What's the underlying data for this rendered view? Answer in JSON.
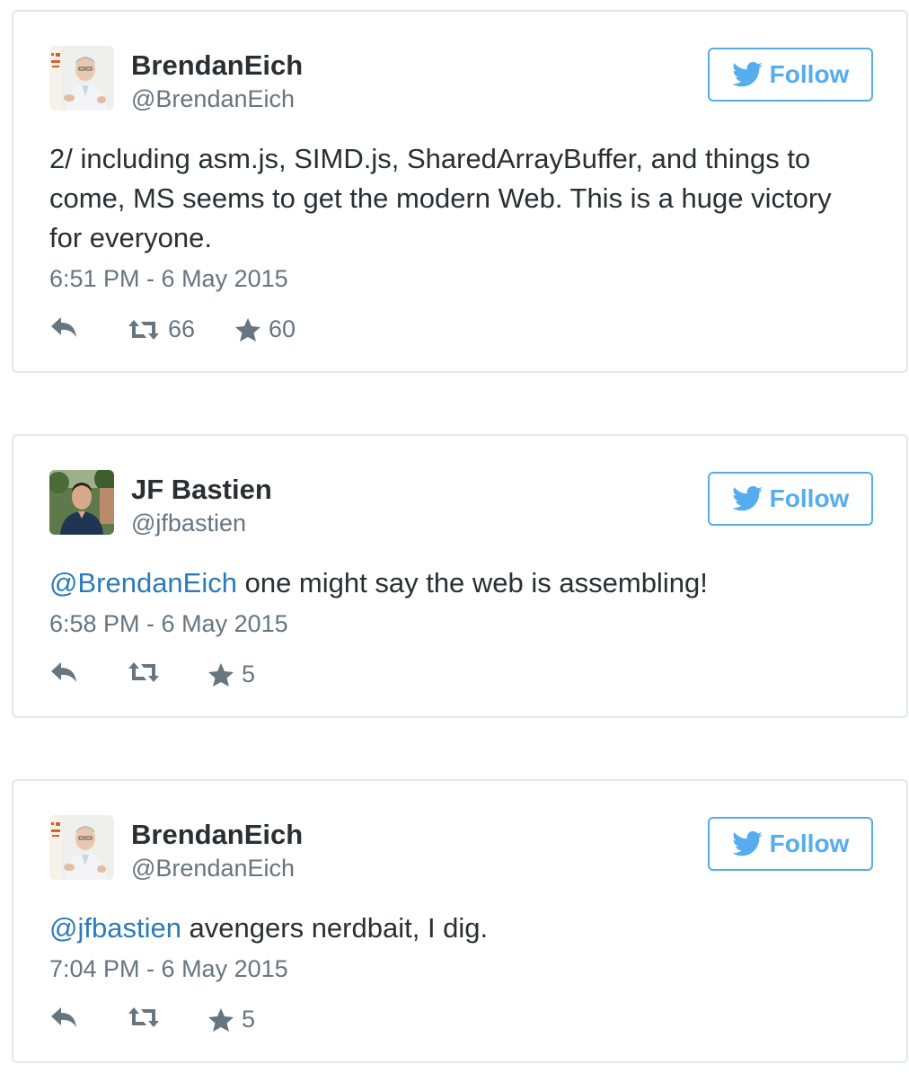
{
  "colors": {
    "accent": "#55acee",
    "link": "#2b7bb9",
    "muted": "#66757f",
    "text": "#292f33",
    "border": "#e1e8ed"
  },
  "tweets": [
    {
      "name": "BrendanEich",
      "handle": "@BrendanEich",
      "follow_label": "Follow",
      "text": "2/ including asm.js, SIMD.js, SharedArrayBuffer, and things to come, MS seems to get the modern Web. This is a huge victory for everyone.",
      "mention": "",
      "time": "6:51 PM - 6 May 2015",
      "retweets": "66",
      "favorites": "60",
      "icons": [
        "reply-icon",
        "retweet-icon",
        "star-icon",
        "twitter-bird-icon"
      ]
    },
    {
      "name": "JF Bastien",
      "handle": "@jfbastien",
      "follow_label": "Follow",
      "mention": "@BrendanEich",
      "text": " one might say the web is assembling!",
      "time": "6:58 PM - 6 May 2015",
      "retweets": "",
      "favorites": "5",
      "icons": [
        "reply-icon",
        "retweet-icon",
        "star-icon",
        "twitter-bird-icon"
      ]
    },
    {
      "name": "BrendanEich",
      "handle": "@BrendanEich",
      "follow_label": "Follow",
      "mention": "@jfbastien",
      "text": " avengers nerdbait, I dig.",
      "time": "7:04 PM - 6 May 2015",
      "retweets": "",
      "favorites": "5",
      "icons": [
        "reply-icon",
        "retweet-icon",
        "star-icon",
        "twitter-bird-icon"
      ]
    }
  ]
}
